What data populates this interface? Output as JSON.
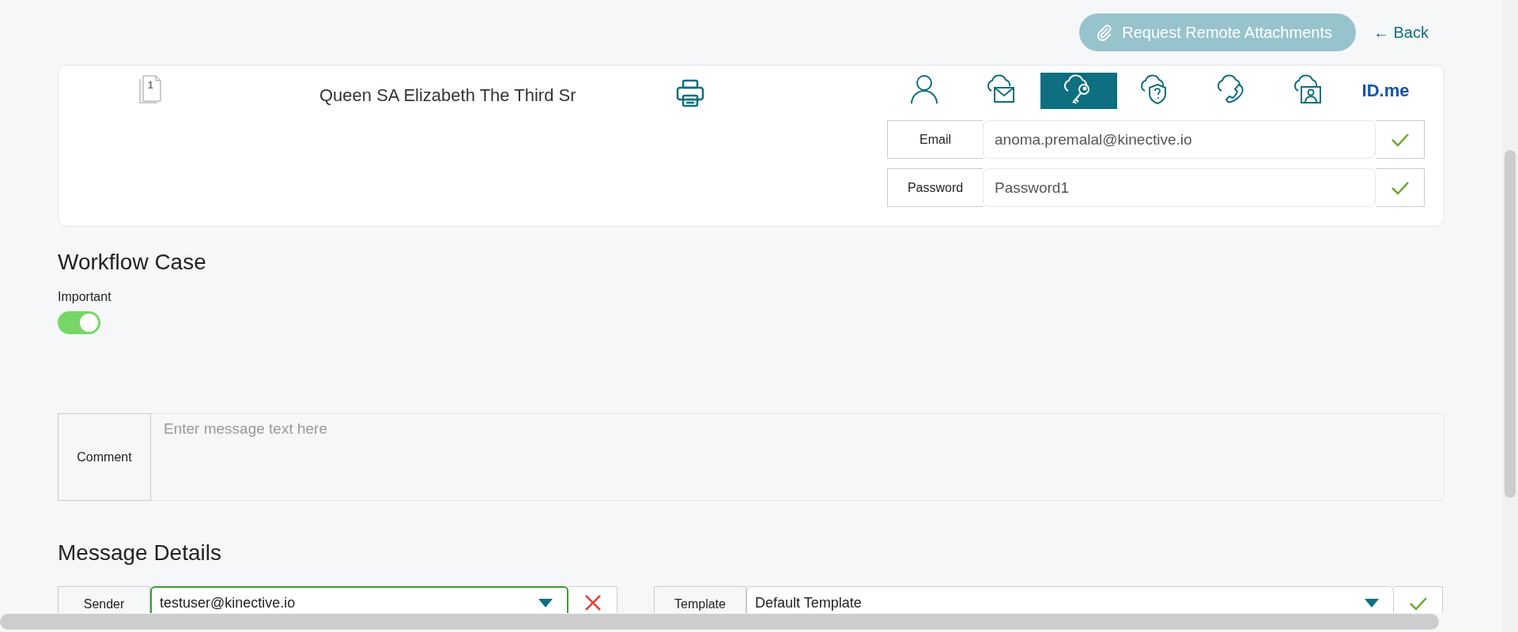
{
  "header": {
    "request_button": "Request Remote Attachments",
    "back_link": "← Back"
  },
  "customer_card": {
    "document_count": "1",
    "customer_name": "Queen SA Elizabeth The Third Sr",
    "contact_tabs": [
      {
        "kind": "person",
        "selected": false
      },
      {
        "kind": "mail",
        "selected": false
      },
      {
        "kind": "key",
        "selected": true
      },
      {
        "kind": "shield",
        "selected": false
      },
      {
        "kind": "phone",
        "selected": false
      },
      {
        "kind": "id",
        "selected": false
      },
      {
        "kind": "idme",
        "label": "ID.me",
        "selected": false
      }
    ],
    "fields": [
      {
        "label": "Email",
        "value": "anoma.premalal@kinective.io",
        "confirmed": true
      },
      {
        "label": "Password",
        "value": "Password1",
        "confirmed": true
      }
    ]
  },
  "workflow_case": {
    "title": "Workflow Case",
    "important": {
      "label": "Important",
      "on": true
    },
    "comment": {
      "label": "Comment",
      "placeholder": "Enter message text here"
    }
  },
  "message_details": {
    "title": "Message Details",
    "sender": {
      "label": "Sender",
      "value": "testuser@kinective.io",
      "focused": true,
      "kind": "clear"
    },
    "template": {
      "label": "Template",
      "value": "Default Template",
      "focused": false,
      "kind": "confirm"
    }
  }
}
